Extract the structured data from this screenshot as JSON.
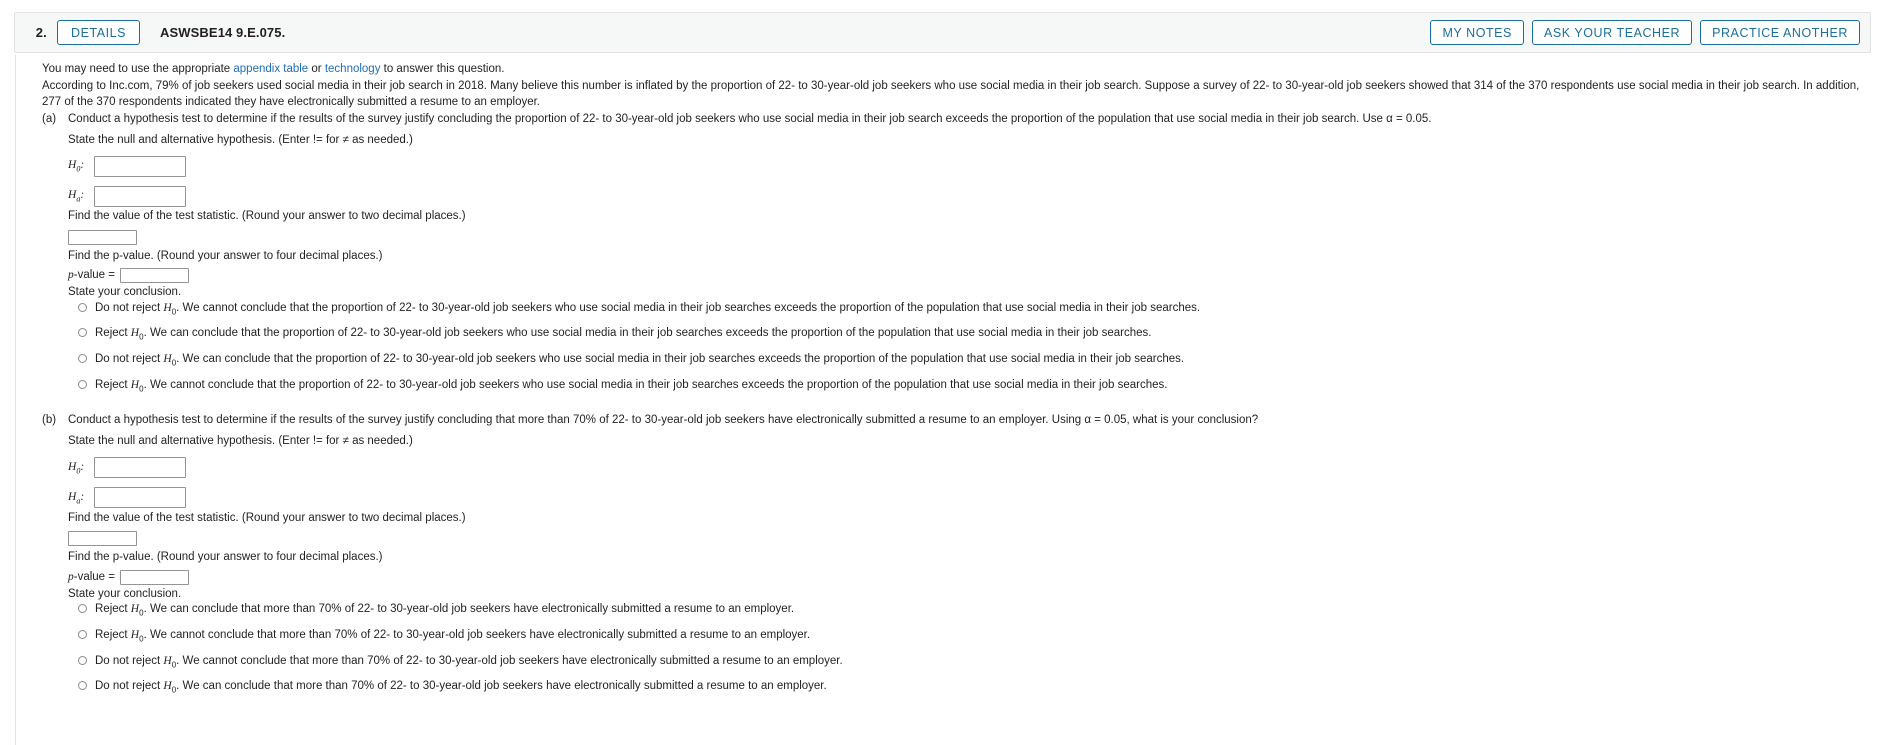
{
  "header": {
    "question_number": "2.",
    "details_label": "DETAILS",
    "question_code": "ASWSBE14 9.E.075.",
    "my_notes_label": "MY NOTES",
    "ask_teacher_label": "ASK YOUR TEACHER",
    "practice_another_label": "PRACTICE ANOTHER",
    "accent_color": "#1a6f9c"
  },
  "intro": {
    "hint_prefix": "You may need to use the appropriate ",
    "link_appendix": "appendix table",
    "hint_mid": " or ",
    "link_technology": "technology",
    "hint_suffix": " to answer this question.",
    "scenario": "According to Inc.com, 79% of job seekers used social media in their job search in 2018. Many believe this number is inflated by the proportion of 22- to 30-year-old job seekers who use social media in their job search. Suppose a survey of 22- to 30-year-old job seekers showed that 314 of the 370 respondents use social media in their job search. In addition, 277 of the 370 respondents indicated they have electronically submitted a resume to an employer."
  },
  "part_a": {
    "label": "(a)",
    "prompt": "Conduct a hypothesis test to determine if the results of the survey justify concluding the proportion of 22- to 30-year-old job seekers who use social media in their job search exceeds the proportion of the population that use social media in their job search. Use α = 0.05.",
    "hypothesis_prompt": "State the null and alternative hypothesis. (Enter != for ≠ as needed.)",
    "h0_label": "H",
    "h0_sub": "0",
    "ha_label": "H",
    "ha_sub": "a",
    "h0_value": "",
    "ha_value": "",
    "test_statistic_prompt": "Find the value of the test statistic. (Round your answer to two decimal places.)",
    "test_statistic_value": "",
    "pvalue_prompt": "Find the p-value. (Round your answer to four decimal places.)",
    "pvalue_label_p": "p",
    "pvalue_label_rest": "-value = ",
    "pvalue_value": "",
    "conclusion_prompt": "State your conclusion.",
    "options": [
      "Do not reject H0. We cannot conclude that the proportion of 22- to 30-year-old job seekers who use social media in their job searches exceeds the proportion of the population that use social media in their job searches.",
      "Reject H0. We can conclude that the proportion of 22- to 30-year-old job seekers who use social media in their job searches exceeds the proportion of the population that use social media in their job searches.",
      "Do not reject H0. We can conclude that the proportion of 22- to 30-year-old job seekers who use social media in their job searches exceeds the proportion of the population that use social media in their job searches.",
      "Reject H0. We cannot conclude that the proportion of 22- to 30-year-old job seekers who use social media in their job searches exceeds the proportion of the population that use social media in their job searches."
    ],
    "options_parts": [
      {
        "lead": "Do not reject ",
        "h": "H",
        "sub": "0",
        "rest": ". We cannot conclude that the proportion of 22- to 30-year-old job seekers who use social media in their job searches exceeds the proportion of the population that use social media in their job searches."
      },
      {
        "lead": "Reject ",
        "h": "H",
        "sub": "0",
        "rest": ". We can conclude that the proportion of 22- to 30-year-old job seekers who use social media in their job searches exceeds the proportion of the population that use social media in their job searches."
      },
      {
        "lead": "Do not reject ",
        "h": "H",
        "sub": "0",
        "rest": ". We can conclude that the proportion of 22- to 30-year-old job seekers who use social media in their job searches exceeds the proportion of the population that use social media in their job searches."
      },
      {
        "lead": "Reject ",
        "h": "H",
        "sub": "0",
        "rest": ". We cannot conclude that the proportion of 22- to 30-year-old job seekers who use social media in their job searches exceeds the proportion of the population that use social media in their job searches."
      }
    ],
    "selected_option": null
  },
  "part_b": {
    "label": "(b)",
    "prompt": "Conduct a hypothesis test to determine if the results of the survey justify concluding that more than 70% of 22- to 30-year-old job seekers have electronically submitted a resume to an employer. Using α = 0.05, what is your conclusion?",
    "hypothesis_prompt": "State the null and alternative hypothesis. (Enter != for ≠ as needed.)",
    "h0_label": "H",
    "h0_sub": "0",
    "ha_label": "H",
    "ha_sub": "a",
    "h0_value": "",
    "ha_value": "",
    "test_statistic_prompt": "Find the value of the test statistic. (Round your answer to two decimal places.)",
    "test_statistic_value": "",
    "pvalue_prompt": "Find the p-value. (Round your answer to four decimal places.)",
    "pvalue_label_p": "p",
    "pvalue_label_rest": "-value = ",
    "pvalue_value": "",
    "conclusion_prompt": "State your conclusion.",
    "options": [
      "Reject H0. We can conclude that more than 70% of 22- to 30-year-old job seekers have electronically submitted a resume to an employer.",
      "Reject H0. We cannot conclude that more than 70% of 22- to 30-year-old job seekers have electronically submitted a resume to an employer.",
      "Do not reject H0. We cannot conclude that more than 70% of 22- to 30-year-old job seekers have electronically submitted a resume to an employer.",
      "Do not reject H0. We can conclude that more than 70% of 22- to 30-year-old job seekers have electronically submitted a resume to an employer."
    ],
    "options_parts": [
      {
        "lead": "Reject ",
        "h": "H",
        "sub": "0",
        "rest": ". We can conclude that more than 70% of 22- to 30-year-old job seekers have electronically submitted a resume to an employer."
      },
      {
        "lead": "Reject ",
        "h": "H",
        "sub": "0",
        "rest": ". We cannot conclude that more than 70% of 22- to 30-year-old job seekers have electronically submitted a resume to an employer."
      },
      {
        "lead": "Do not reject ",
        "h": "H",
        "sub": "0",
        "rest": ". We cannot conclude that more than 70% of 22- to 30-year-old job seekers have electronically submitted a resume to an employer."
      },
      {
        "lead": "Do not reject ",
        "h": "H",
        "sub": "0",
        "rest": ". We can conclude that more than 70% of 22- to 30-year-old job seekers have electronically submitted a resume to an employer."
      }
    ],
    "selected_option": null
  }
}
